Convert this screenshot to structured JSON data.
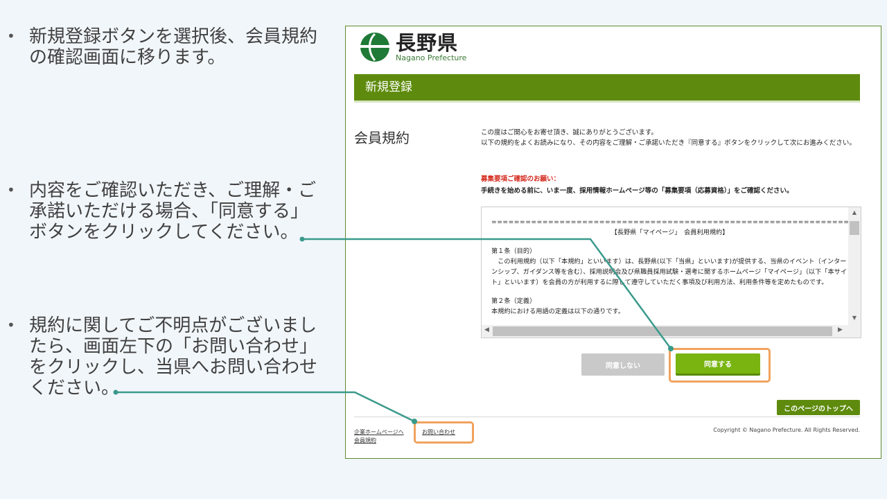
{
  "slide": {
    "bullets": [
      {
        "marker": "•",
        "text": "新規登録ボタンを選択後、会員規約\nの確認画面に移ります。"
      },
      {
        "marker": "•",
        "text": "内容をご確認いただき、ご理解・ご\n承諾いただける場合、「同意する」\nボタンをクリックしてください。"
      },
      {
        "marker": "•",
        "text": "規約に関してご不明点がございまし\nたら、画面左下の「お問い合わせ」\nをクリックし、当県へお問い合わせ\nください。"
      }
    ],
    "accent_colors": {
      "connector": "#3a9a8c",
      "highlight": "#f0a35e"
    }
  },
  "site": {
    "logo": {
      "name_jp": "長野県",
      "name_en": "Nagano Prefecture",
      "brand_color": "#1e7a36"
    },
    "page_bar": "新規登録",
    "section_title": "会員規約",
    "intro": "この度はご関心をお寄せ頂き、誠にありがとうございます。\n以下の規約をよくお読みになり、その内容をご理解・ご承諾いただき『同意する』ボタンをクリックして次にお進みください。",
    "notice": {
      "title": "募集要項ご確認のお願い：",
      "body": "手続きを始める前に、いま一度、採用情報ホームページ等の「募集要項（応募資格）」をご確認ください。"
    },
    "terms": {
      "separator": "======================================================================================",
      "heading": "【長野県「マイページ」　会員利用規約】",
      "article1_title": "第１条（目的）",
      "article1_body": "　この利用規約（以下「本規約」といいます）は、長野県(以下「当県」といいます)が提供する、当県のイベント（インターンシップ、ガイダンス等を含む）、採用説明会及び県職員採用試験・選考に関するホームページ「マイページ」（以下「本サイト」といいます）を会員の方が利用するに際して遵守していただく事項及び利用方法、利用条件等を定めたものです。",
      "article2_title": "第２条（定義）",
      "article2_body": "本規約における用語の定義は以下の通りです。"
    },
    "buttons": {
      "disagree": "同意しない",
      "agree": "同意する",
      "page_top": "このページのトップへ"
    },
    "footer": {
      "link_home": "企業ホームページへ",
      "link_terms": "会員規約",
      "link_contact": "お問い合わせ",
      "copyright": "Copyright © Nagano Prefecture. All Rights Reserved."
    }
  }
}
